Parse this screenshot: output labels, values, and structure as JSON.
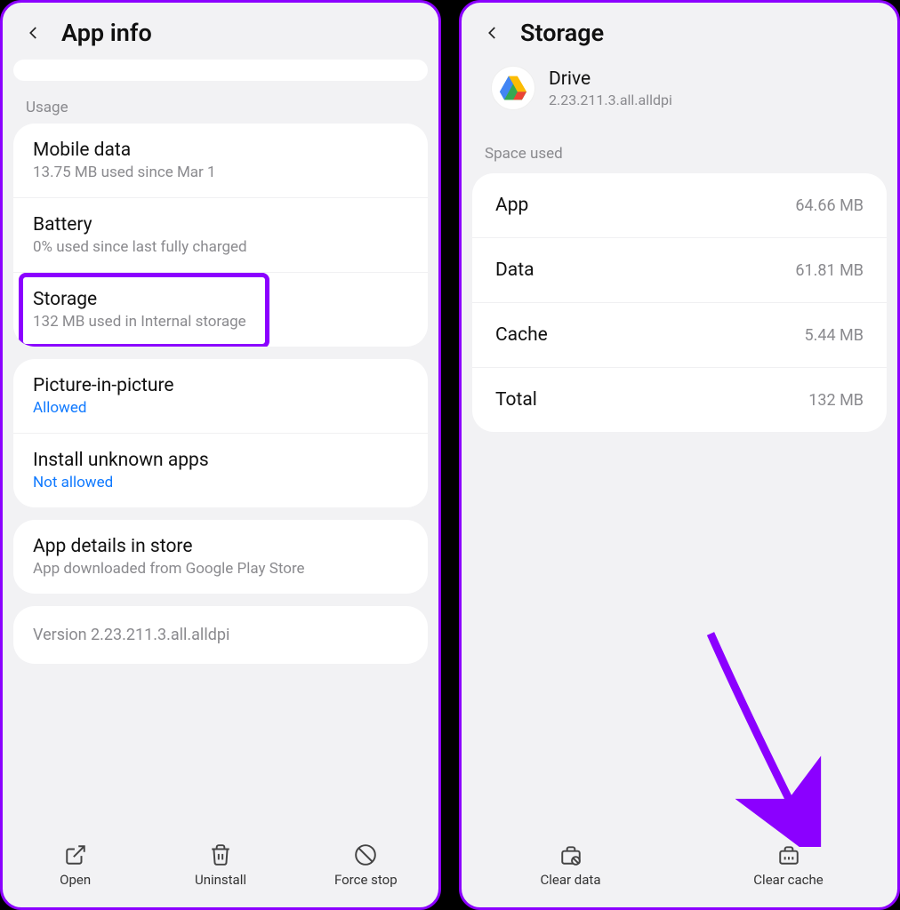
{
  "left": {
    "title": "App info",
    "usage_label": "Usage",
    "rows": {
      "mobile_data": {
        "title": "Mobile data",
        "sub": "13.75 MB used since Mar 1"
      },
      "battery": {
        "title": "Battery",
        "sub": "0% used since last fully charged"
      },
      "storage": {
        "title": "Storage",
        "sub": "132 MB used in Internal storage"
      },
      "pip": {
        "title": "Picture-in-picture",
        "sub": "Allowed"
      },
      "unknown": {
        "title": "Install unknown apps",
        "sub": "Not allowed"
      },
      "details": {
        "title": "App details in store",
        "sub": "App downloaded from Google Play Store"
      }
    },
    "version": "Version 2.23.211.3.all.alldpi",
    "bottom": {
      "open": "Open",
      "uninstall": "Uninstall",
      "forcestop": "Force stop"
    }
  },
  "right": {
    "title": "Storage",
    "app": {
      "name": "Drive",
      "version": "2.23.211.3.all.alldpi"
    },
    "space_label": "Space used",
    "rows": {
      "app": {
        "label": "App",
        "value": "64.66 MB"
      },
      "data": {
        "label": "Data",
        "value": "61.81 MB"
      },
      "cache": {
        "label": "Cache",
        "value": "5.44 MB"
      },
      "total": {
        "label": "Total",
        "value": "132 MB"
      }
    },
    "bottom": {
      "clear_data": "Clear data",
      "clear_cache": "Clear cache"
    }
  }
}
